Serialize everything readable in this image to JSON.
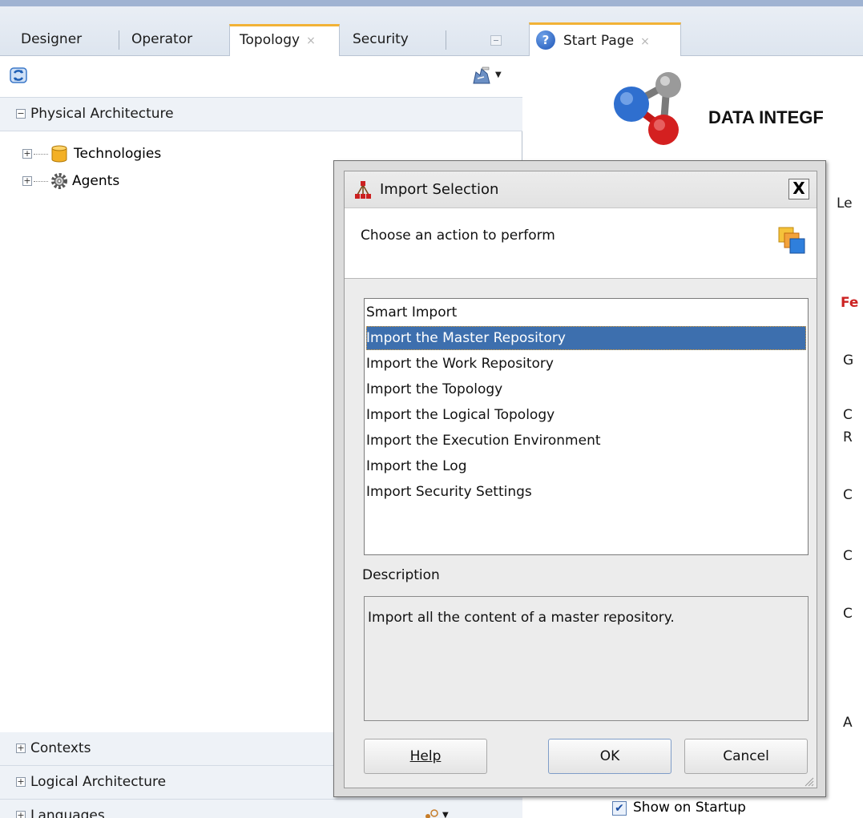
{
  "left_tabs": [
    {
      "label": "Designer"
    },
    {
      "label": "Operator"
    },
    {
      "label": "Topology",
      "active": true
    },
    {
      "label": "Security"
    }
  ],
  "tab_close_glyph": "×",
  "accordion": {
    "physical": "Physical Architecture",
    "contexts": "Contexts",
    "logical": "Logical Architecture",
    "languages": "Languages"
  },
  "tree": {
    "technologies": "Technologies",
    "agents": "Agents"
  },
  "editor": {
    "tab_label": "Start Page",
    "tab_icon_glyph": "?",
    "heading": "DATA INTEGF",
    "side_fragments": [
      "Le",
      "Fe",
      "G",
      "C",
      "R",
      "C",
      "C",
      "C",
      "A"
    ],
    "show_on_startup": "Show on Startup",
    "show_on_startup_checked": true
  },
  "dialog": {
    "title": "Import Selection",
    "close_glyph": "X",
    "header_text": "Choose an action to perform",
    "actions": [
      "Smart Import",
      "Import the Master Repository",
      "Import the Work Repository",
      "Import the Topology",
      "Import the Logical Topology",
      "Import the Execution Environment",
      "Import the Log",
      "Import Security Settings"
    ],
    "selected_index": 1,
    "description_label": "Description",
    "description_text": "Import all the content of a master repository.",
    "buttons": {
      "help": "Help",
      "ok": "OK",
      "cancel": "Cancel"
    }
  },
  "icons": {
    "refresh": "refresh-icon",
    "connect": "connect-icon",
    "technologies": "database-cylinder-icon",
    "agents": "gear-icon",
    "import": "import-hierarchy-icon",
    "header": "stacked-squares-icon"
  },
  "colors": {
    "selection": "#3d6fae",
    "active_tab_accent": "#f2b236",
    "dialog_bg": "#ececec",
    "follow_up_red": "#cc2222"
  }
}
